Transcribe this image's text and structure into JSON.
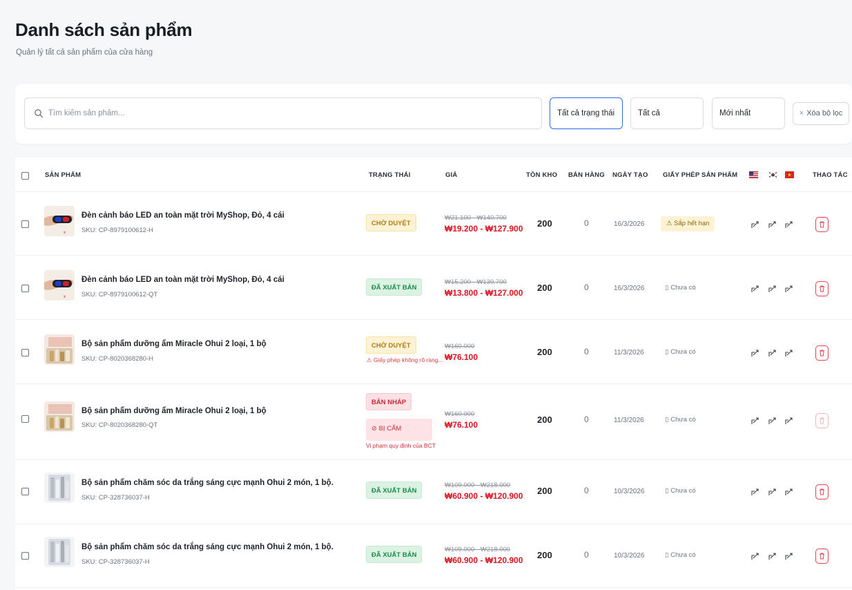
{
  "header": {
    "title": "Danh sách sản phẩm",
    "subtitle": "Quản lý tất cả sản phẩm của cửa hàng"
  },
  "filters": {
    "search_placeholder": "Tìm kiếm sản phẩm...",
    "status": "Tất cả trạng thái",
    "category": "Tất cả",
    "sort": "Mới nhất",
    "clear": "Xóa bộ lọc"
  },
  "table": {
    "columns": {
      "product": "SẢN PHẨM",
      "status": "TRẠNG THÁI",
      "price": "GIÁ",
      "stock": "TỒN KHO",
      "sold": "BÁN HÀNG",
      "created": "NGÀY TẠO",
      "license": "GIẤY PHÉP SẢN PHẨM",
      "flags": [
        "us-flag-icon",
        "kr-flag-icon",
        "vn-flag-icon"
      ],
      "actions": "THAO TÁC"
    },
    "rows": [
      {
        "name": "Đèn cảnh báo LED an toàn mặt trời MyShop, Đỏ, 4 cái",
        "sku": "SKU: CP-8979100612-H",
        "thumb": "led-light",
        "status": "CHỜ DUYỆT",
        "status_type": "pending",
        "price_old": "₩21.100 - ₩140.700",
        "price_new": "₩19.200 - ₩127.900",
        "stock": "200",
        "sold": "0",
        "created": "16/3/2026",
        "license": "⚠ Sắp hết hạn",
        "license_type": "expiring"
      },
      {
        "name": "Đèn cảnh báo LED an toàn mặt trời MyShop, Đỏ, 4 cái",
        "sku": "SKU: CP-8979100612-QT",
        "thumb": "led-light",
        "status": "ĐÃ XUẤT BẢN",
        "status_type": "published",
        "price_old": "₩15.200 - ₩139.700",
        "price_new": "₩13.800 - ₩127.000",
        "stock": "200",
        "sold": "0",
        "created": "16/3/2026",
        "license": "Chưa có",
        "license_type": "none"
      },
      {
        "name": "Bộ sản phẩm dưỡng ẩm Miracle Ohui 2 loại, 1 bộ",
        "sku": "SKU: CP-8020368280-H",
        "thumb": "cosmetic-set",
        "status": "CHỜ DUYỆT",
        "status_type": "pending",
        "status_note": "⚠ Giấy phép không rõ ràng...",
        "price_old": "₩160.000",
        "price_new": "₩76.100",
        "stock": "200",
        "sold": "0",
        "created": "11/3/2026",
        "license": "Chưa có",
        "license_type": "none"
      },
      {
        "name": "Bộ sản phẩm dưỡng ẩm Miracle Ohui 2 loại, 1 bộ",
        "sku": "SKU: CP-8020368280-QT",
        "thumb": "cosmetic-set",
        "status": "BẢN NHÁP",
        "status_type": "draft",
        "ban_label": "⊘ BỊ CẤM",
        "ban_note": "Vi phạm quy định của BCT",
        "price_old": "₩160.000",
        "price_new": "₩76.100",
        "stock": "200",
        "sold": "0",
        "created": "11/3/2026",
        "license": "Chưa có",
        "license_type": "none"
      },
      {
        "name": "Bộ sản phẩm chăm sóc da trắng sáng cực mạnh Ohui 2 món, 1 bộ.",
        "sku": "SKU: CP-328736037-H",
        "thumb": "skincare-set",
        "status": "ĐÃ XUẤT BẢN",
        "status_type": "published",
        "price_old": "₩109.000 - ₩218.000",
        "price_new": "₩60.900 - ₩120.900",
        "stock": "200",
        "sold": "0",
        "created": "10/3/2026",
        "license": "Chưa có",
        "license_type": "none"
      },
      {
        "name": "Bộ sản phẩm chăm sóc da trắng sáng cực mạnh Ohui 2 món, 1 bộ.",
        "sku": "SKU: CP-328736037-H",
        "thumb": "skincare-set",
        "status": "ĐÃ XUẤT BẢN",
        "status_type": "published",
        "price_old": "₩109.000 - ₩218.000",
        "price_new": "₩60.900 - ₩120.900",
        "stock": "200",
        "sold": "0",
        "created": "10/3/2026",
        "license": "Chưa có",
        "license_type": "none"
      }
    ]
  },
  "colors": {
    "accent": "#2f6fe4",
    "price_sale": "#e0121f",
    "danger": "#e8424f"
  }
}
